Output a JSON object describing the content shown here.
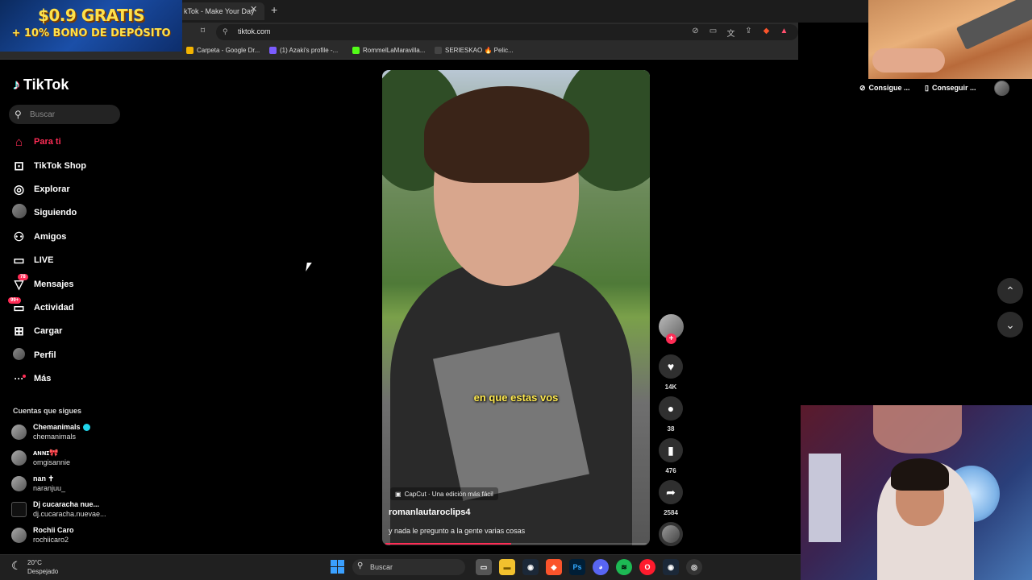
{
  "ad": {
    "line1": "$0.9 GRATIS",
    "line2": "+ 10% BONO DE DEPÓSITO"
  },
  "browser": {
    "tab_title": "kTok - Make Your Day",
    "tab_close": "✕",
    "new_tab": "+",
    "url": "tiktok.com",
    "bookmarks": [
      {
        "label": "Carpeta - Google Dr...",
        "color": "#f4b400"
      },
      {
        "label": "(1) Azaki's profile -...",
        "color": "#7b5cff"
      },
      {
        "label": "RommelLaMaravilla...",
        "color": "#53fc18"
      },
      {
        "label": "SERIESKAO 🔥 Pelic...",
        "color": "#444444"
      }
    ]
  },
  "sidebar": {
    "logo": "TikTok",
    "search_placeholder": "Buscar",
    "nav": [
      {
        "label": "Para ti",
        "icon": "home-icon",
        "glyph": "⌂"
      },
      {
        "label": "TikTok Shop",
        "icon": "shop-icon",
        "glyph": "▢"
      },
      {
        "label": "Explorar",
        "icon": "compass-icon",
        "glyph": "◎"
      },
      {
        "label": "Siguiendo",
        "icon": "following-avatar",
        "glyph": ""
      },
      {
        "label": "Amigos",
        "icon": "friends-icon",
        "glyph": "⚇"
      },
      {
        "label": "LIVE",
        "icon": "live-icon",
        "glyph": "▭"
      },
      {
        "label": "Mensajes",
        "icon": "messages-icon",
        "glyph": "▽",
        "badge": "78"
      },
      {
        "label": "Actividad",
        "icon": "activity-icon",
        "glyph": "▭",
        "badge": "99+"
      },
      {
        "label": "Cargar",
        "icon": "upload-icon",
        "glyph": "⊞"
      },
      {
        "label": "Perfil",
        "icon": "profile-avatar",
        "glyph": ""
      },
      {
        "label": "Más",
        "icon": "more-icon",
        "glyph": "···"
      }
    ],
    "following_heading": "Cuentas que sigues",
    "following": [
      {
        "name": "Chemanimals",
        "handle": "chemanimals",
        "verified": true
      },
      {
        "name": "ᴀɴɴɪ🎀",
        "handle": "omgisannie"
      },
      {
        "name": "nan ✝",
        "handle": "naranjuu_"
      },
      {
        "name": "Dj cucaracha nue...",
        "handle": "dj.cucaracha.nuevae..."
      },
      {
        "name": "Rochii Caro",
        "handle": "rochiicaro2"
      }
    ]
  },
  "video": {
    "caption": "en que estas vos",
    "capcut_label": "CapCut · Una edición más fácil",
    "author": "romanlautaroclips4",
    "description": "y nada le pregunto a la gente varias cosas",
    "progress": 0.48
  },
  "actions": {
    "likes": "14K",
    "comments": "38",
    "saves": "476",
    "shares": "2584"
  },
  "topright": {
    "coins": "Consigue ...",
    "app": "Conseguir ..."
  },
  "taskbar": {
    "temp": "20°C",
    "weather": "Despejado",
    "search": "Buscar"
  }
}
